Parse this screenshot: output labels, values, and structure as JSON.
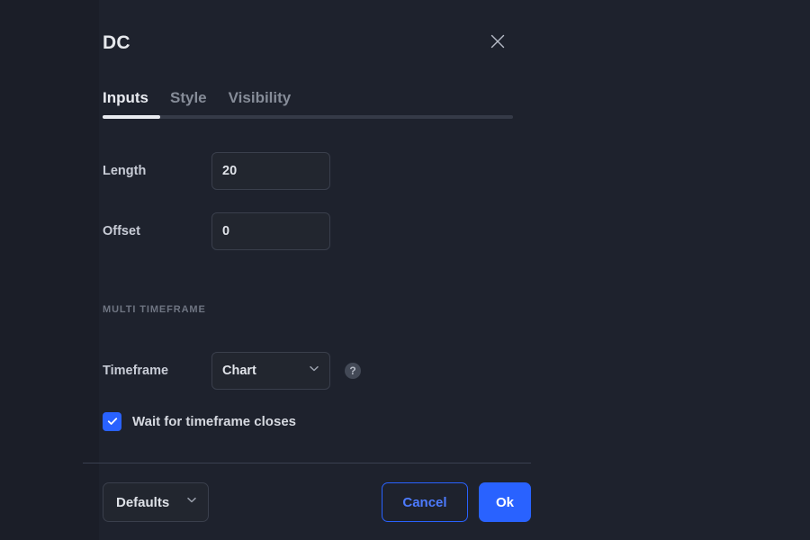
{
  "dialog": {
    "title": "DC",
    "close_icon": "close-icon",
    "tabs": [
      {
        "label": "Inputs",
        "active": true
      },
      {
        "label": "Style",
        "active": false
      },
      {
        "label": "Visibility",
        "active": false
      }
    ]
  },
  "inputs": {
    "length": {
      "label": "Length",
      "value": "20"
    },
    "offset": {
      "label": "Offset",
      "value": "0"
    }
  },
  "multi_timeframe": {
    "section_label": "MULTI TIMEFRAME",
    "timeframe": {
      "label": "Timeframe",
      "value": "Chart",
      "chevron_icon": "chevron-down-icon",
      "help_icon": "help-circle-icon",
      "help_glyph": "?"
    },
    "wait_for_closes": {
      "label": "Wait for timeframe closes",
      "checked": true,
      "check_icon": "check-icon"
    }
  },
  "footer": {
    "defaults": {
      "label": "Defaults",
      "chevron_icon": "chevron-down-icon"
    },
    "cancel_label": "Cancel",
    "ok_label": "Ok"
  },
  "colors": {
    "accent": "#2962ff",
    "dialog_bg": "#1e222d",
    "field_bg": "#22262f",
    "field_border": "#3a3f4c",
    "text_primary": "#e1e4ea",
    "text_muted": "#6f7582",
    "tab_rail": "#353a47",
    "tab_rail_active": "#e9ebf0"
  }
}
